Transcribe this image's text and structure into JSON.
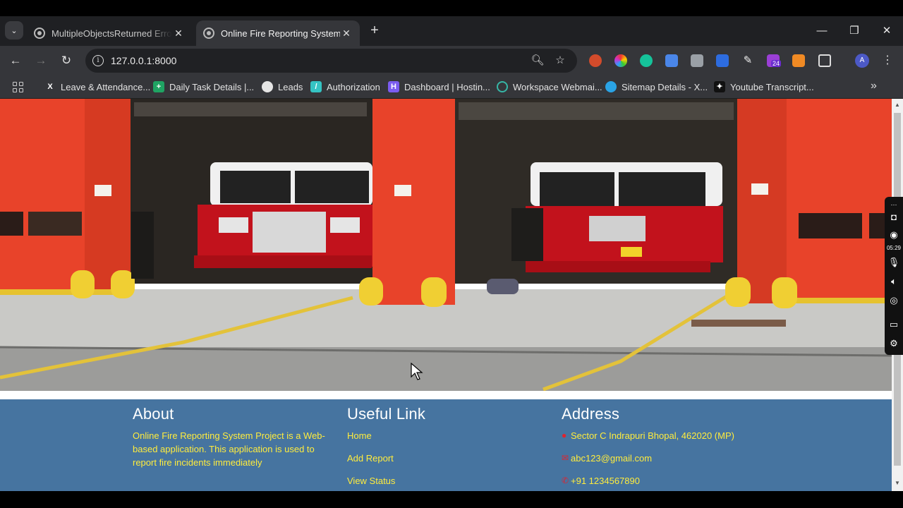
{
  "browser": {
    "tabs": [
      {
        "title": "MultipleObjectsReturned Error /",
        "active": false
      },
      {
        "title": "Online Fire Reporting System",
        "active": true
      }
    ],
    "address_bar": {
      "url": "127.0.0.1:8000"
    },
    "bookmarks": [
      {
        "label": "Leave & Attendance...",
        "icon": "x-icon",
        "color": "#ffffff"
      },
      {
        "label": "Daily Task Details |...",
        "icon": "sheets-icon",
        "color": "#1fa463"
      },
      {
        "label": "Leads",
        "icon": "leads-icon",
        "color": "#e5e5e5"
      },
      {
        "label": "Authorization",
        "icon": "auth-icon",
        "color": "#35c3c3"
      },
      {
        "label": "Dashboard | Hostin...",
        "icon": "hostinger-icon",
        "color": "#7b5cf0"
      },
      {
        "label": "Workspace Webmai...",
        "icon": "webmail-icon",
        "color": "#36b6a6"
      },
      {
        "label": "Sitemap Details - X...",
        "icon": "sitemap-icon",
        "color": "#2aa3e5"
      },
      {
        "label": "Youtube Transcript...",
        "icon": "transcript-icon",
        "color": "#111111"
      }
    ],
    "profile_initial": "A",
    "extension_badge": "24"
  },
  "page": {
    "footer": {
      "about": {
        "heading": "About",
        "text": "Online Fire Reporting System Project is a Web-based application. This application is used to report fire incidents immediately"
      },
      "useful_link": {
        "heading": "Useful Link",
        "links": [
          "Home",
          "Add Report",
          "View Status"
        ]
      },
      "address": {
        "heading": "Address",
        "location": "Sector C Indrapuri Bhopal, 462020 (MP)",
        "email": "abc123@gmail.com",
        "phone": "+91 1234567890"
      }
    },
    "colors": {
      "footer_bg": "#4674a0",
      "footer_link": "#ffec3d",
      "hero_door_red": "#e8432a"
    }
  },
  "recorder_panel": {
    "timer": "05:29"
  }
}
